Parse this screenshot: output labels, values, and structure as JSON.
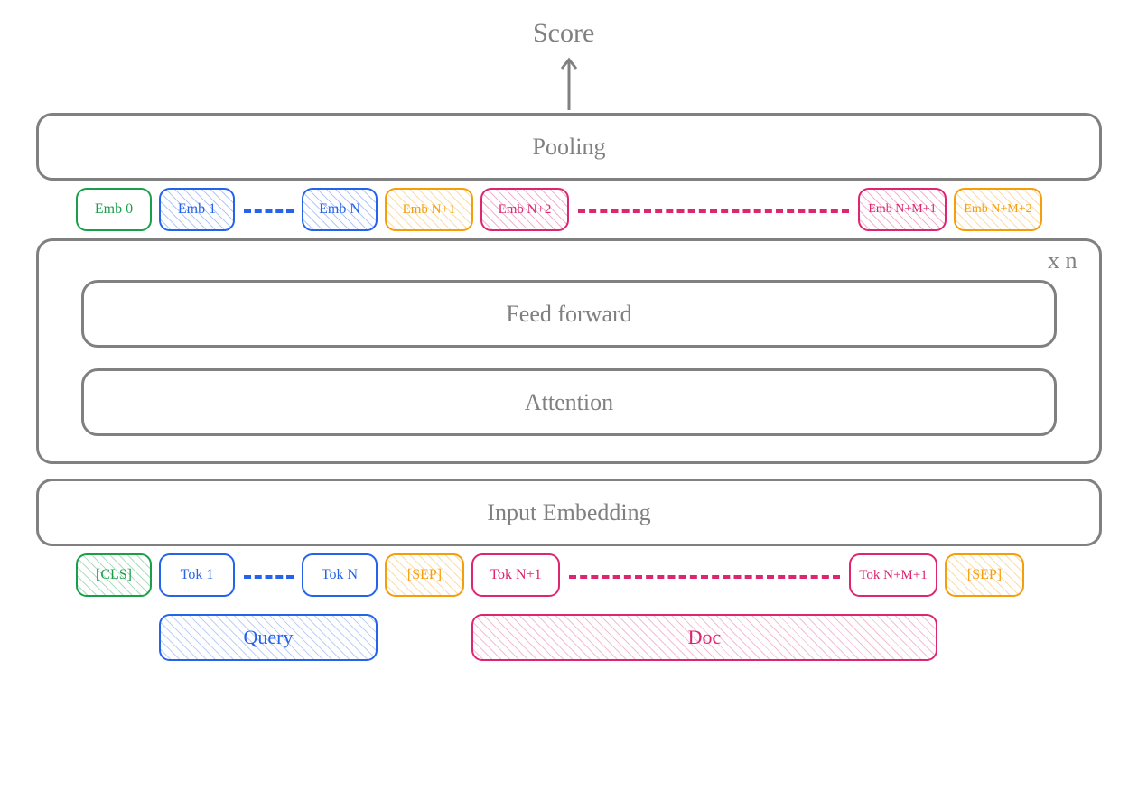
{
  "score": "Score",
  "pooling": "Pooling",
  "feedforward": "Feed forward",
  "attention": "Attention",
  "input_embedding": "Input Embedding",
  "repeat": "x n",
  "query_label": "Query",
  "doc_label": "Doc",
  "emb": {
    "e0": "Emb 0",
    "e1": "Emb 1",
    "eN": "Emb N",
    "eN1": "Emb N+1",
    "eN2": "Emb N+2",
    "eNM1": "Emb N+M+1",
    "eNM2": "Emb N+M+2"
  },
  "tok": {
    "cls": "[CLS]",
    "t1": "Tok 1",
    "tN": "Tok N",
    "sep1": "[SEP]",
    "tN1": "Tok N+1",
    "tNM1": "Tok N+M+1",
    "sep2": "[SEP]"
  },
  "colors": {
    "gray": "#808080",
    "green": "#1a9e4a",
    "blue": "#2563eb",
    "orange": "#f59e0b",
    "red": "#dc2670"
  }
}
